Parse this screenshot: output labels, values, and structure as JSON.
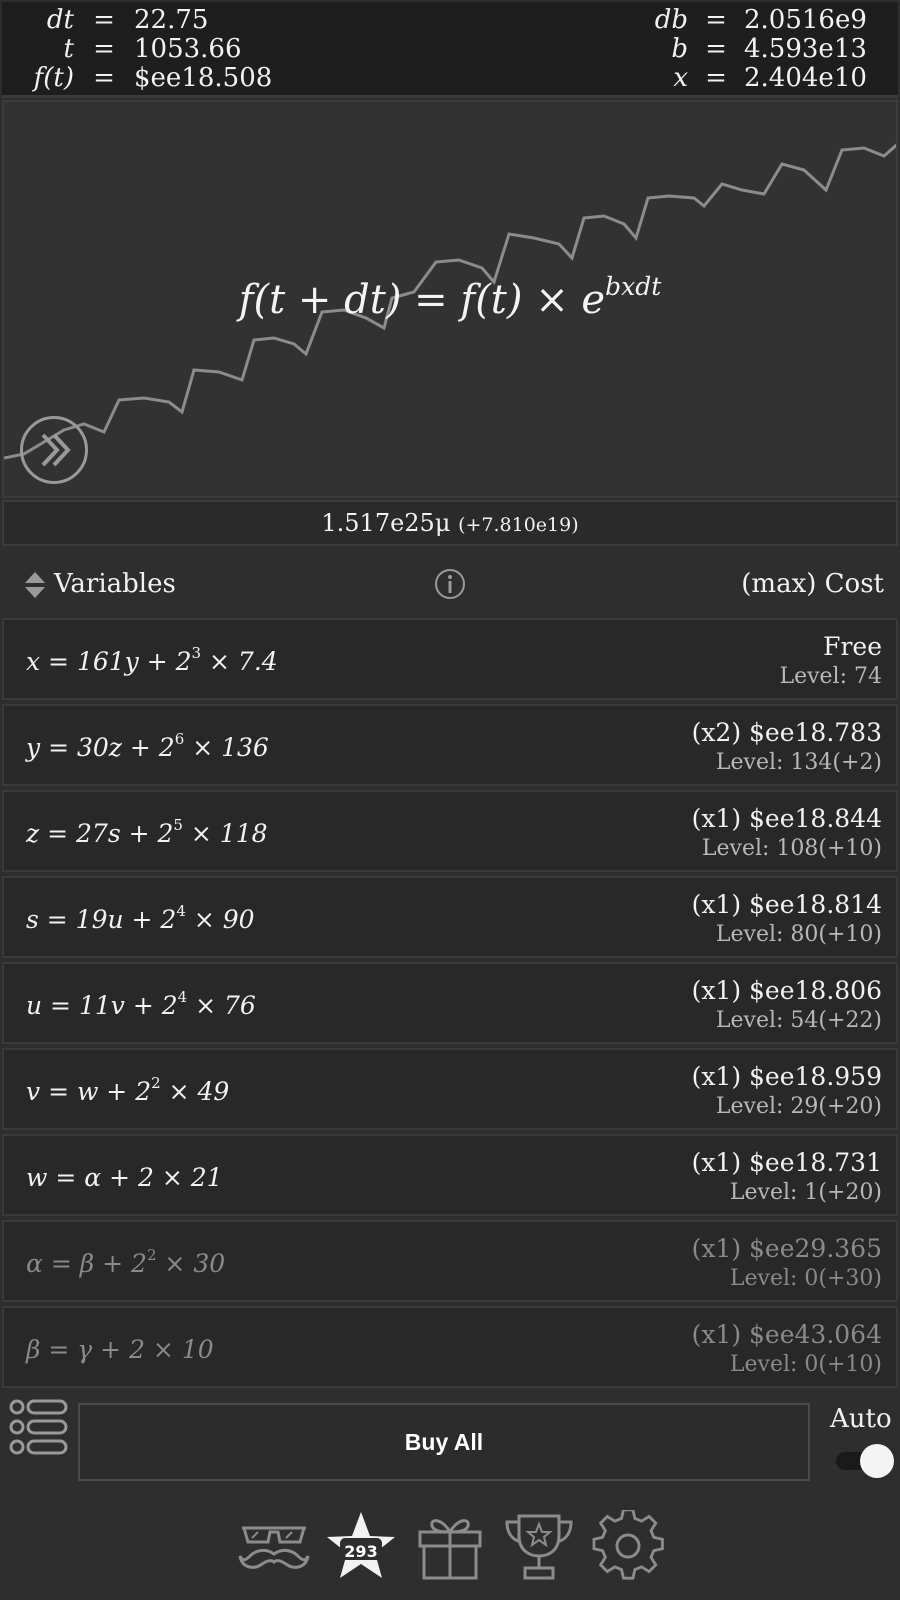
{
  "stats": {
    "dt": {
      "name": "dt",
      "value": "22.75"
    },
    "t": {
      "name": "t",
      "value": "1053.66"
    },
    "ft": {
      "name": "f(t)",
      "value": "$ee18.508"
    },
    "db": {
      "name": "db",
      "value": "2.0516e9"
    },
    "b": {
      "name": "b",
      "value": "4.593e13"
    },
    "x": {
      "name": "x",
      "value": "2.404e10"
    },
    "eq": "="
  },
  "graph": {
    "formula_main": "f(t + dt) = f(t) × e",
    "formula_exp": "bxdt",
    "curve_color": "#8c8c8c"
  },
  "currency": {
    "value": "1.517e25μ",
    "rate": "(+7.810e19)"
  },
  "header": {
    "title": "Variables",
    "cost": "(max) Cost"
  },
  "upgrades": [
    {
      "lhs": "x = 161y + 2",
      "exp": "3",
      "rhs": " × 7.4",
      "cost": "Free",
      "level": "Level: 74",
      "enabled": true
    },
    {
      "lhs": "y = 30z + 2",
      "exp": "6",
      "rhs": " × 136",
      "cost": "(x2) $ee18.783",
      "level": "Level: 134(+2)",
      "enabled": true
    },
    {
      "lhs": "z = 27s + 2",
      "exp": "5",
      "rhs": " × 118",
      "cost": "(x1) $ee18.844",
      "level": "Level: 108(+10)",
      "enabled": true
    },
    {
      "lhs": "s = 19u + 2",
      "exp": "4",
      "rhs": " × 90",
      "cost": "(x1) $ee18.814",
      "level": "Level: 80(+10)",
      "enabled": true
    },
    {
      "lhs": "u = 11v + 2",
      "exp": "4",
      "rhs": " × 76",
      "cost": "(x1) $ee18.806",
      "level": "Level: 54(+22)",
      "enabled": true
    },
    {
      "lhs": "v = w + 2",
      "exp": "2",
      "rhs": " × 49",
      "cost": "(x1) $ee18.959",
      "level": "Level: 29(+20)",
      "enabled": true
    },
    {
      "lhs": "w = α + 2 × 21",
      "exp": "",
      "rhs": "",
      "cost": "(x1) $ee18.731",
      "level": "Level: 1(+20)",
      "enabled": true
    },
    {
      "lhs": "α = β + 2",
      "exp": "2",
      "rhs": " × 30",
      "cost": "(x1) $ee29.365",
      "level": "Level: 0(+30)",
      "enabled": false
    },
    {
      "lhs": "β = γ + 2 × 10",
      "exp": "",
      "rhs": "",
      "cost": "(x1) $ee43.064",
      "level": "Level: 0(+10)",
      "enabled": false
    }
  ],
  "controls": {
    "buy_all": "Buy All",
    "auto": "Auto",
    "auto_on": true
  },
  "nav": {
    "star_count": "293"
  }
}
